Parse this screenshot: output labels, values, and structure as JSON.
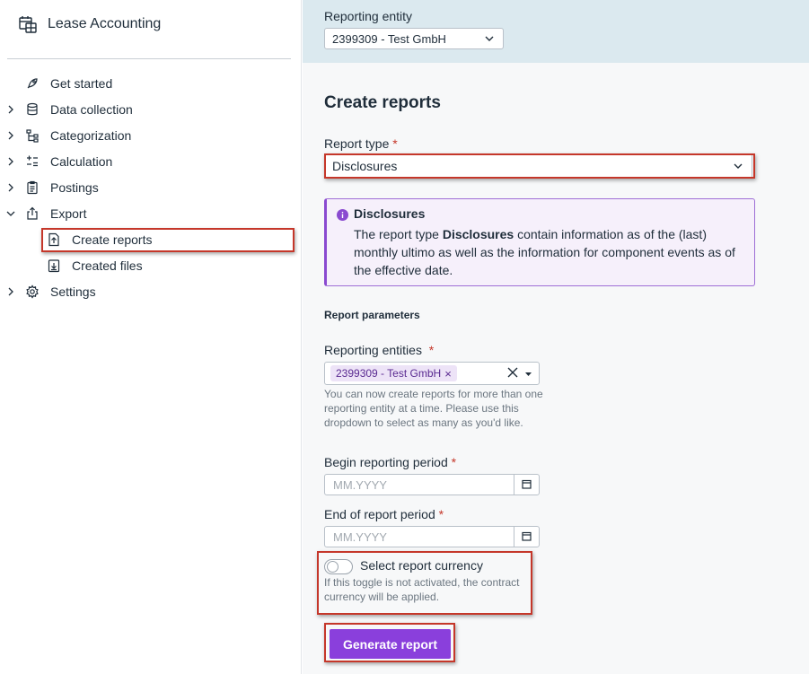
{
  "app": {
    "title": "Lease Accounting",
    "icon": "calendar-grid-icon"
  },
  "sidebar": {
    "items": [
      {
        "label": "Get started",
        "icon": "rocket-icon"
      },
      {
        "label": "Data collection",
        "icon": "database-icon"
      },
      {
        "label": "Categorization",
        "icon": "hierarchy-icon"
      },
      {
        "label": "Calculation",
        "icon": "calculator-icon"
      },
      {
        "label": "Postings",
        "icon": "clipboard-icon"
      },
      {
        "label": "Export",
        "icon": "export-icon"
      },
      {
        "label": "Create reports",
        "icon": "file-add-icon"
      },
      {
        "label": "Created files",
        "icon": "file-download-icon"
      },
      {
        "label": "Settings",
        "icon": "gear-icon"
      }
    ]
  },
  "topbar": {
    "label": "Reporting entity",
    "value": "2399309 - Test GmbH"
  },
  "main": {
    "title": "Create reports",
    "report_type": {
      "label": "Report type",
      "required": "*",
      "value": "Disclosures"
    },
    "info": {
      "title": "Disclosures",
      "text_pre": "The report type ",
      "text_bold": "Disclosures",
      "text_post": " contain information as of the (last) monthly ultimo as well as the information for component events as of the effective date."
    },
    "section": "Report parameters",
    "entities": {
      "label": "Reporting entities",
      "required": "*",
      "chip": "2399309 - Test GmbH",
      "help": "You can now create reports for more than one reporting entity at a time. Please use this dropdown to select as many as you'd like."
    },
    "begin": {
      "label": "Begin reporting period",
      "required": "*",
      "placeholder": "MM.YYYY"
    },
    "end": {
      "label": "End of report period",
      "required": "*",
      "placeholder": "MM.YYYY"
    },
    "currency": {
      "label": "Select report currency",
      "help": "If this toggle is not activated, the contract currency will be applied."
    },
    "generate_label": "Generate report"
  },
  "colors": {
    "accent": "#8a3fdc",
    "highlight": "#c5372a",
    "topbar_bg": "#dbe9ef"
  }
}
